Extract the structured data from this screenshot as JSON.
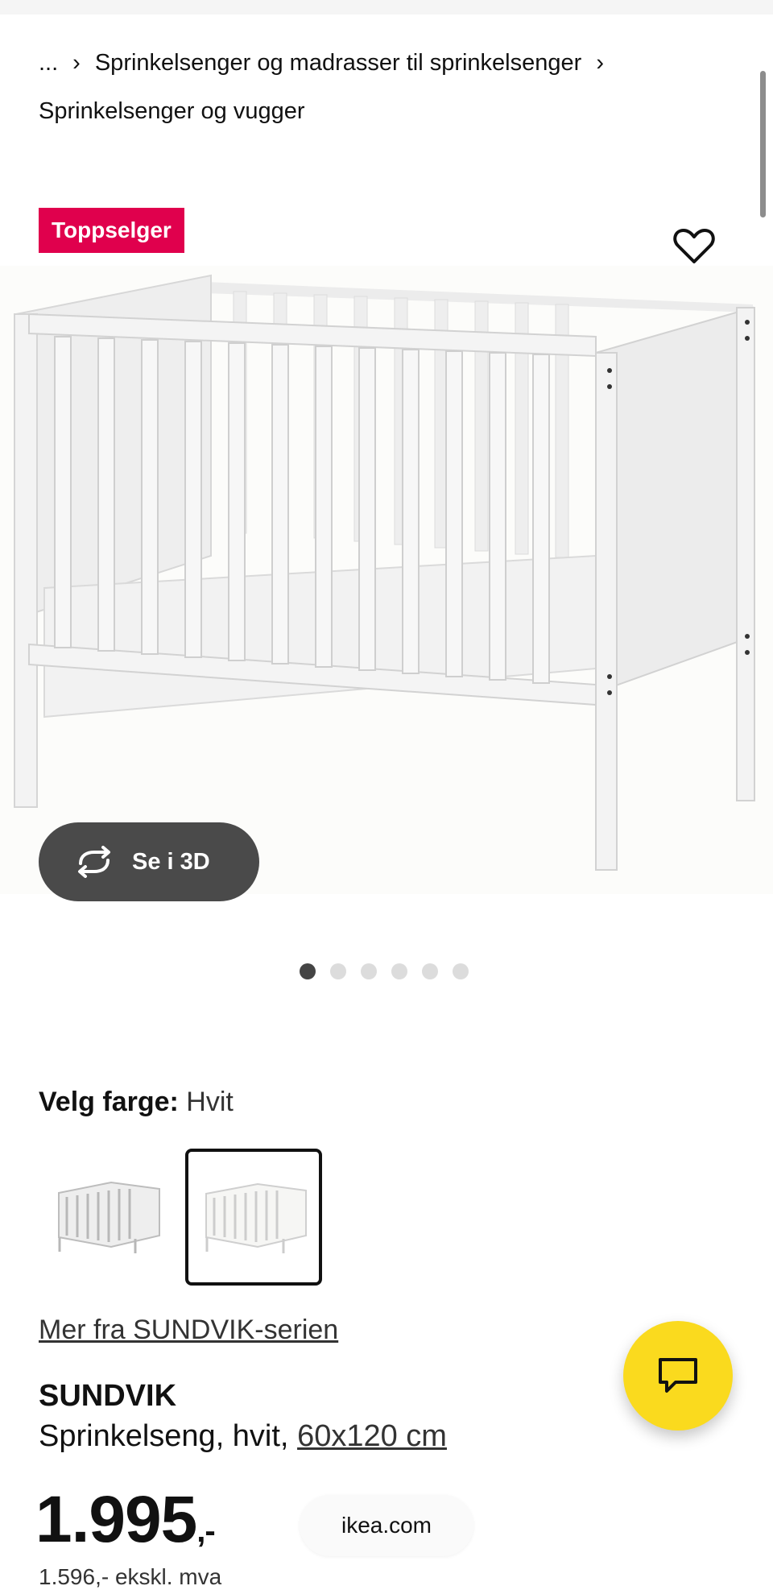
{
  "breadcrumb": {
    "ellipsis": "...",
    "category": "Sprinkelsenger og madrasser til sprinkelsenger",
    "current": "Sprinkelsenger og vugger"
  },
  "badge": "Toppselger",
  "icons": {
    "favorite": "heart-outline-icon",
    "rotate_3d": "rotate-arrows-icon",
    "chat": "chat-bubble-icon",
    "separator": "chevron-right-icon"
  },
  "view_3d_label": "Se i 3D",
  "carousel": {
    "count": 6,
    "active_index": 0
  },
  "color": {
    "label": "Velg farge:",
    "value": "Hvit"
  },
  "swatches": [
    {
      "name": "grey-white",
      "selected": false
    },
    {
      "name": "white",
      "selected": true
    }
  ],
  "series_link": "Mer fra SUNDVIK-serien",
  "product": {
    "name": "SUNDVIK",
    "description": "Sprinkelseng, hvit,",
    "size": "60x120 cm"
  },
  "price": {
    "main": "1.995",
    "suffix": ",-",
    "excl_vat": "1.596,- ekskl. mva"
  },
  "domain": "ikea.com",
  "colors": {
    "badge": "#e0004d",
    "chat_button": "#fada1e",
    "dark_button": "#4a4a4a"
  }
}
